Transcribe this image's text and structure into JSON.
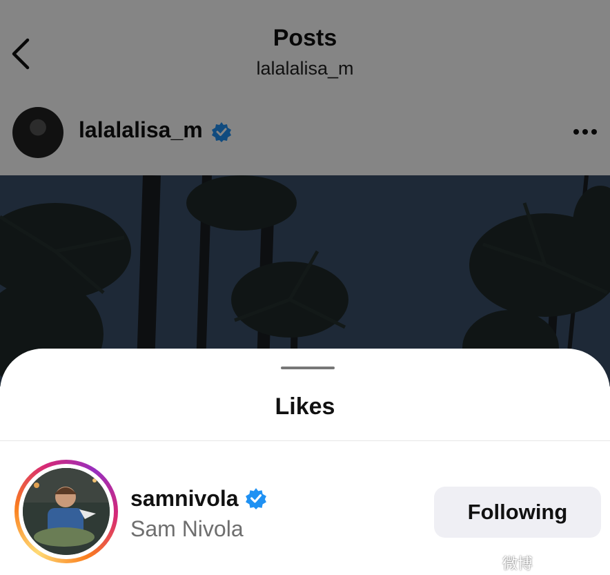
{
  "header": {
    "title": "Posts",
    "subtitle": "lalalalisa_m",
    "back_icon": "chevron-left-icon"
  },
  "post": {
    "username": "lalalalisa_m",
    "verified_icon": "verified-badge-icon",
    "more_icon": "more-horizontal-icon"
  },
  "sheet": {
    "title": "Likes"
  },
  "likes": [
    {
      "username": "samnivola",
      "full_name": "Sam Nivola",
      "verified": true,
      "button_label": "Following"
    }
  ],
  "colors": {
    "verified_blue": "#1f91f3",
    "overlay": "rgba(0,0,0,0.48)",
    "button_bg": "#efeff4",
    "sky": "#3c4f68"
  },
  "watermark": "微博"
}
